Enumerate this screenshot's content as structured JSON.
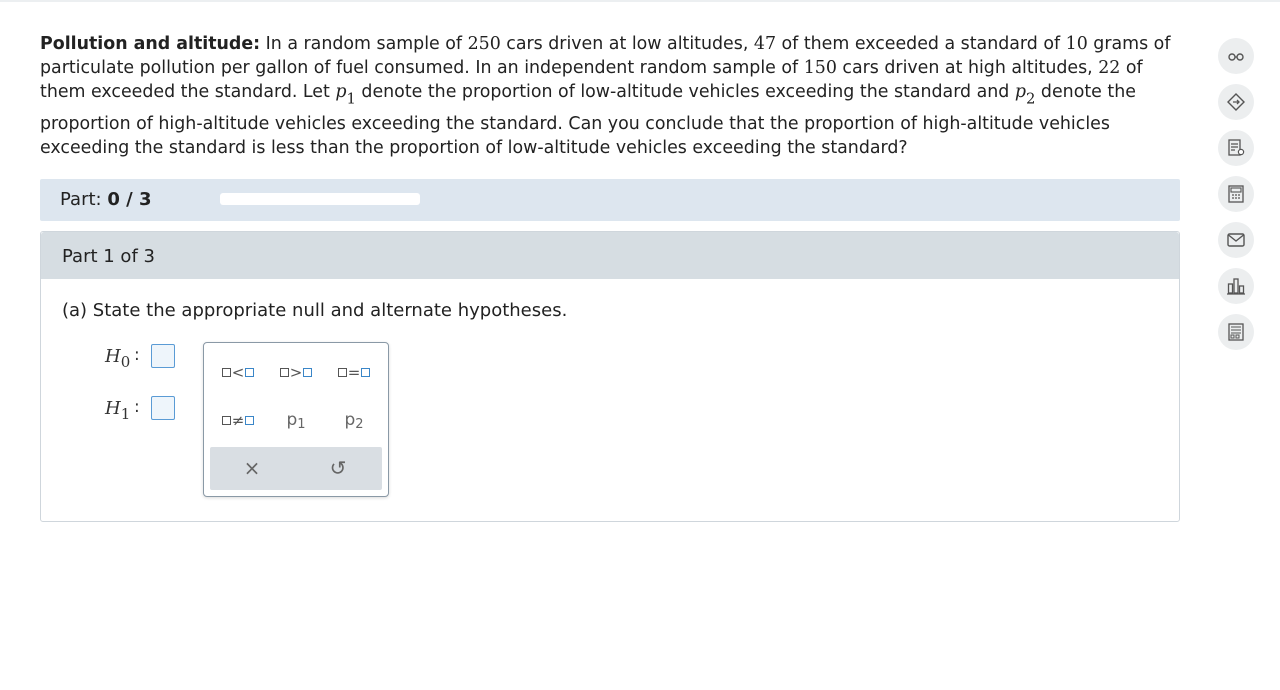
{
  "problem": {
    "title": "Pollution and altitude:",
    "t1": " In a random sample of ",
    "n1": "250",
    "t2": " cars driven at low altitudes, ",
    "x1": "47",
    "t3": " of them exceeded a standard of ",
    "std": "10",
    "t4": " grams of particulate pollution per gallon of fuel consumed. In an independent random sample of ",
    "n2": "150",
    "t5": " cars driven at high altitudes, ",
    "x2": "22",
    "t6": " of them exceeded the standard. Let ",
    "p_var": "p",
    "p1_sub": "1",
    "t7": " denote the proportion of low-altitude vehicles exceeding the standard and ",
    "p2_sub": "2",
    "t8": " denote the proportion of high-altitude vehicles exceeding the standard. Can you conclude that the proportion of high-altitude vehicles exceeding the standard is less than the proportion of low-altitude vehicles exceeding the standard?"
  },
  "progress": {
    "label": "Part:",
    "value": "0 / 3",
    "fraction": 0
  },
  "part": {
    "header": "Part 1 of 3",
    "question": "(a) State the appropriate null and alternate hypotheses."
  },
  "hypotheses": {
    "h_var": "H",
    "h0_sub": "0",
    "h1_sub": "1",
    "colon": ":"
  },
  "palette": {
    "less_than": "<",
    "greater_than": ">",
    "equals": "=",
    "not_equal": "≠",
    "p_var": "p",
    "p1_sub": "1",
    "p2_sub": "2",
    "clear_symbol": "×",
    "undo_symbol": "↺"
  },
  "toolbar_icons": [
    "glasses-icon",
    "tag-icon",
    "notes-icon",
    "calculator-icon",
    "mail-icon",
    "stats-icon",
    "data-table-icon"
  ]
}
